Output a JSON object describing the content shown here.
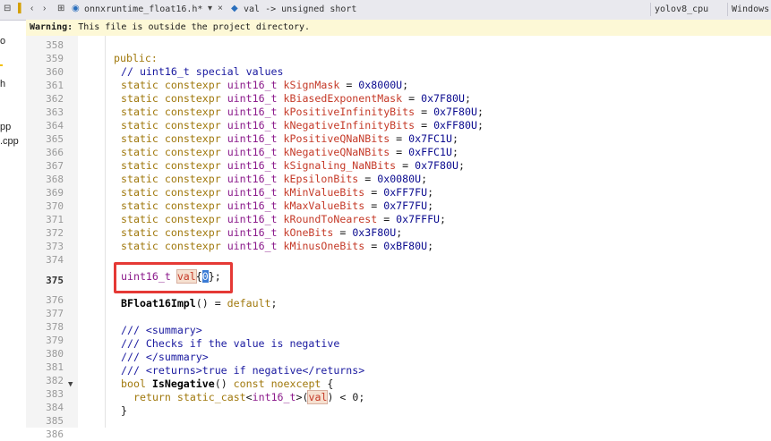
{
  "left_panel": {
    "fragments": [
      "o",
      "h",
      "pp",
      ".cpp"
    ]
  },
  "tab": {
    "title": "onnxruntime_float16.h*",
    "close": "×"
  },
  "breadcrumb": "val -> unsigned short",
  "config": "yolov8_cpu",
  "platform": "Windows",
  "warning": {
    "label": "Warning:",
    "text": " This file is outside the project directory."
  },
  "editor": {
    "lines": [
      {
        "n": "358"
      },
      {
        "n": "359"
      },
      {
        "n": "360"
      },
      {
        "n": "361"
      },
      {
        "n": "362"
      },
      {
        "n": "363"
      },
      {
        "n": "364"
      },
      {
        "n": "365"
      },
      {
        "n": "366"
      },
      {
        "n": "367"
      },
      {
        "n": "368"
      },
      {
        "n": "369"
      },
      {
        "n": "370"
      },
      {
        "n": "371"
      },
      {
        "n": "372"
      },
      {
        "n": "373"
      },
      {
        "n": "374"
      },
      {
        "n": "375"
      },
      {
        "n": "376"
      },
      {
        "n": "377"
      },
      {
        "n": "378"
      },
      {
        "n": "379"
      },
      {
        "n": "380"
      },
      {
        "n": "381"
      },
      {
        "n": "382"
      },
      {
        "n": "383"
      },
      {
        "n": "384"
      },
      {
        "n": "385"
      },
      {
        "n": "386"
      }
    ],
    "public": "public:",
    "comment_special": "// uint16_t special values",
    "consts": [
      {
        "name": "kSignMask",
        "value": "0x8000U"
      },
      {
        "name": "kBiasedExponentMask",
        "value": "0x7F80U"
      },
      {
        "name": "kPositiveInfinityBits",
        "value": "0x7F80U"
      },
      {
        "name": "kNegativeInfinityBits",
        "value": "0xFF80U"
      },
      {
        "name": "kPositiveQNaNBits",
        "value": "0x7FC1U"
      },
      {
        "name": "kNegativeQNaNBits",
        "value": "0xFFC1U"
      },
      {
        "name": "kSignaling_NaNBits",
        "value": "0x7F80U"
      },
      {
        "name": "kEpsilonBits",
        "value": "0x0080U"
      },
      {
        "name": "kMinValueBits",
        "value": "0xFF7FU"
      },
      {
        "name": "kMaxValueBits",
        "value": "0x7F7FU"
      },
      {
        "name": "kRoundToNearest",
        "value": "0x7FFFU"
      },
      {
        "name": "kOneBits",
        "value": "0x3F80U"
      },
      {
        "name": "kMinusOneBits",
        "value": "0xBF80U"
      }
    ],
    "static_kw": "static",
    "constexpr_kw": "constexpr",
    "type_uint16": "uint16_t",
    "val_decl": {
      "type": "uint16_t",
      "name": "val",
      "init": "0"
    },
    "ctor": {
      "name": "BFloat16Impl",
      "rest": "() = ",
      "default": "default",
      "end": ";"
    },
    "doc": [
      "/// <summary>",
      "/// Checks if the value is negative",
      "/// </summary>",
      "/// <returns>true if negative</returns>"
    ],
    "isneg": {
      "bool": "bool",
      "name": "IsNegative",
      "rest": "() ",
      "const": "const",
      "noexcept": "noexcept",
      "brace": "{"
    },
    "ret": {
      "return": "return",
      "cast": "static_cast",
      "type": "int16_t",
      "val": "val",
      "rest": " < 0;"
    },
    "close_brace": "}"
  }
}
